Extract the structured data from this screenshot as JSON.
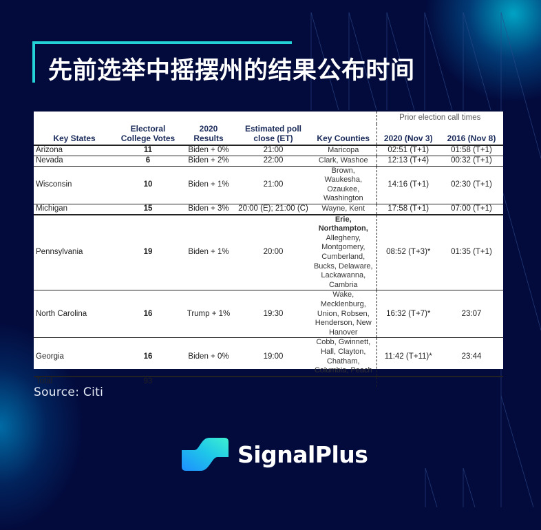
{
  "title": "先前选举中摇摆州的结果公布时间",
  "table": {
    "headers": {
      "state": "Key States",
      "ev_line1": "Electoral",
      "ev_line2": "College Votes",
      "results_line1": "2020",
      "results_line2": "Results",
      "poll_line1": "Estimated poll",
      "poll_line2": "close (ET)",
      "counties": "Key Counties",
      "prior_group": "Prior election call times",
      "call_2020": "2020 (Nov 3)",
      "call_2016": "2016 (Nov 8)"
    },
    "rows": [
      {
        "state": "Arizona",
        "ev": "11",
        "result": "Biden + 0%",
        "poll_close": "21:00",
        "counties_bold": "",
        "counties": "Maricopa",
        "call_2020": "02:51 (T+1)",
        "call_2016": "01:58 (T+1)"
      },
      {
        "state": "Nevada",
        "ev": "6",
        "result": "Biden + 2%",
        "poll_close": "22:00",
        "counties_bold": "",
        "counties": "Clark, Washoe",
        "call_2020": "12:13 (T+4)",
        "call_2016": "00:32 (T+1)"
      },
      {
        "state": "Wisconsin",
        "ev": "10",
        "result": "Biden + 1%",
        "poll_close": "21:00",
        "counties_bold": "",
        "counties": "Brown, Waukesha, Ozaukee, Washington",
        "call_2020": "14:16 (T+1)",
        "call_2016": "02:30 (T+1)"
      },
      {
        "state": "Michigan",
        "ev": "15",
        "result": "Biden + 3%",
        "poll_close": "20:00 (E); 21:00 (C)",
        "counties_bold": "",
        "counties": "Wayne, Kent",
        "call_2020": "17:58 (T+1)",
        "call_2016": "07:00 (T+1)"
      },
      {
        "state": "Pennsylvania",
        "ev": "19",
        "result": "Biden + 1%",
        "poll_close": "20:00",
        "counties_bold": "Erie, Northampton,",
        "counties": "Allegheny, Montgomery, Cumberland, Bucks, Delaware, Lackawanna, Cambria",
        "call_2020": "08:52 (T+3)*",
        "call_2016": "01:35 (T+1)"
      },
      {
        "state": "North Carolina",
        "ev": "16",
        "result": "Trump + 1%",
        "poll_close": "19:30",
        "counties_bold": "",
        "counties": "Wake, Mecklenburg, Union, Robsen, Henderson, New Hanover",
        "call_2020": "16:32 (T+7)*",
        "call_2016": "23:07"
      },
      {
        "state": "Georgia",
        "ev": "16",
        "result": "Biden + 0%",
        "poll_close": "19:00",
        "counties_bold": "",
        "counties": "Cobb, Gwinnett, Hall, Clayton, Chatham, Columbia, Peach",
        "call_2020": "11:42 (T+11)*",
        "call_2016": "23:44"
      }
    ],
    "total": {
      "label": "Total",
      "ev": "93"
    }
  },
  "source": "Source: Citi",
  "logo": {
    "text": "SignalPlus",
    "icon": "signalplus-logo-icon"
  },
  "colors": {
    "background": "#030a3c",
    "accent": "#22d3d8",
    "header_text": "#1a2a5a"
  }
}
